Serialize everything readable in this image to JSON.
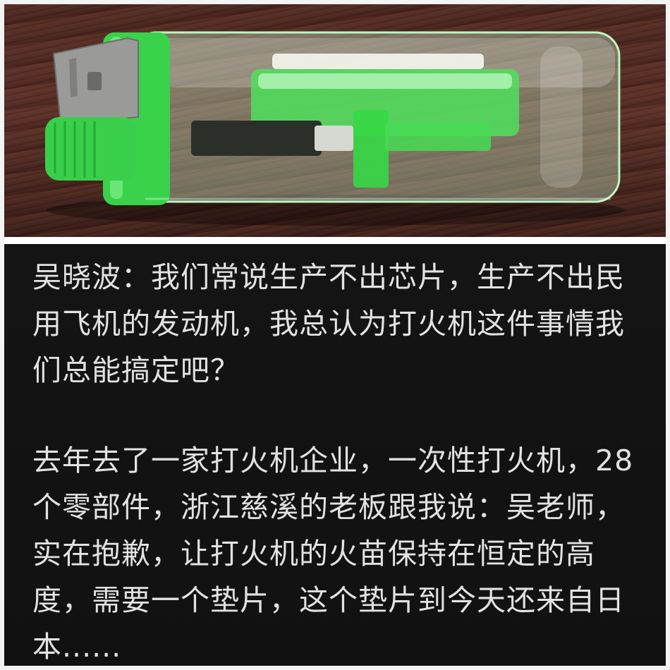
{
  "photo": {
    "subject": "green-disposable-lighter",
    "colors": {
      "plastic": "#39d24a",
      "metal": "#9a9a98",
      "wood": "#4e2a23"
    }
  },
  "text": {
    "paragraph1": "吴晓波：我们常说生产不出芯片，生产不出民用飞机的发动机，我总认为打火机这件事情我们总能搞定吧？",
    "paragraph2": "去年去了一家打火机企业，一次性打火机，28个零部件，浙江慈溪的老板跟我说：吴老师，实在抱歉，让打火机的火苗保持在恒定的高度，需要一个垫片，这个垫片到今天还来自日本......"
  },
  "colors": {
    "text": "#e2e2e2",
    "panel_bg": "#141414"
  }
}
